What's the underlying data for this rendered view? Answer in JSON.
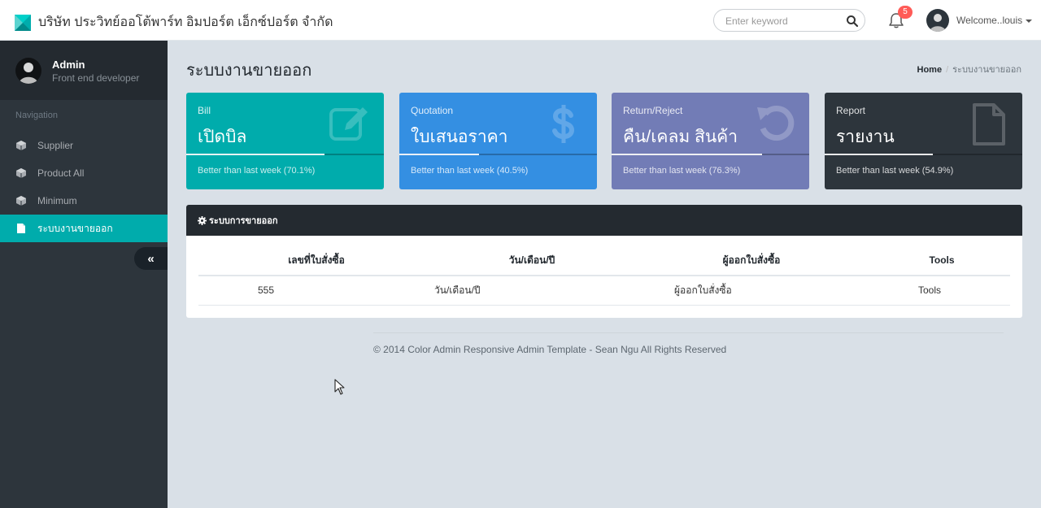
{
  "header": {
    "brand": "บริษัท ประวิทย์ออโต้พาร์ท อิมปอร์ต เอ็กซ์ปอร์ต จำกัด",
    "search_placeholder": "Enter keyword",
    "notifications_count": "5",
    "user_greeting": "Welcome..louis"
  },
  "sidebar": {
    "profile_name": "Admin",
    "profile_role": "Front end developer",
    "nav_header": "Navigation",
    "items": [
      {
        "label": "Supplier"
      },
      {
        "label": "Product All"
      },
      {
        "label": "Minimum"
      },
      {
        "label": "ระบบงานขายออก"
      }
    ],
    "minify_label": "«"
  },
  "page": {
    "title": "ระบบงานขายออก",
    "breadcrumb_home": "Home",
    "breadcrumb_sep": "/",
    "breadcrumb_current": "ระบบงานขายออก"
  },
  "stats": [
    {
      "label": "Bill",
      "value": "เปิดบิล",
      "desc": "Better than last week (70.1%)",
      "progress": 0.701,
      "color": "#00acac",
      "icon": "edit-icon"
    },
    {
      "label": "Quotation",
      "value": "ใบเสนอราคา",
      "desc": "Better than last week (40.5%)",
      "progress": 0.405,
      "color": "#348fe2",
      "icon": "dollar-icon"
    },
    {
      "label": "Return/Reject",
      "value": "คืน/เคลม สินค้า",
      "desc": "Better than last week (76.3%)",
      "progress": 0.763,
      "color": "#727cb6",
      "icon": "undo-icon"
    },
    {
      "label": "Report",
      "value": "รายงาน",
      "desc": "Better than last week (54.9%)",
      "progress": 0.549,
      "color": "#2d353c",
      "icon": "file-icon"
    }
  ],
  "panel": {
    "title": "ระบบการขายออก",
    "columns": [
      "เลขที่ใบสั่งซื้อ",
      "วัน/เดือน/ปี",
      "ผู้ออกใบสั่งซื้อ",
      "Tools"
    ],
    "rows": [
      [
        "555",
        "วัน/เดือน/ปี",
        "ผู้ออกใบสั่งซื้อ",
        "Tools"
      ]
    ]
  },
  "footer": {
    "text": "© 2014 Color Admin Responsive Admin Template - Sean Ngu All Rights Reserved"
  }
}
